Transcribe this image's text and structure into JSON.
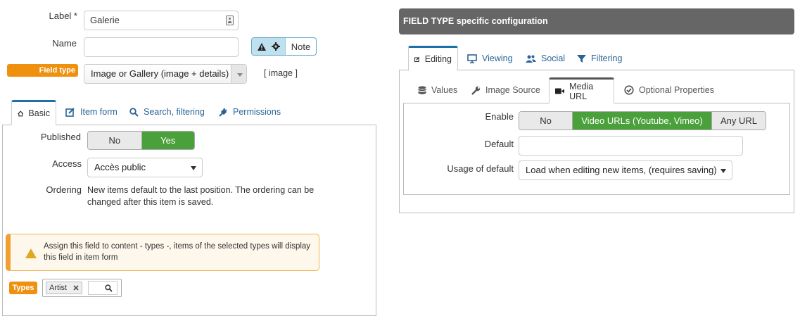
{
  "form": {
    "label_label": "Label *",
    "label_value": "Galerie",
    "name_label": "Name",
    "name_value": "",
    "note_label": "Note",
    "field_type_badge": "Field type",
    "field_type_value": "Image or Gallery (image + details)",
    "field_type_code": "[ image ]"
  },
  "left_tabs": [
    {
      "label": "Basic",
      "icon": "home-icon",
      "active": true
    },
    {
      "label": "Item form",
      "icon": "edit-icon",
      "active": false
    },
    {
      "label": "Search, filtering",
      "icon": "search-icon",
      "active": false
    },
    {
      "label": "Permissions",
      "icon": "plug-icon",
      "active": false
    }
  ],
  "basic": {
    "published_label": "Published",
    "published_options": [
      "No",
      "Yes"
    ],
    "published_selected": "Yes",
    "access_label": "Access",
    "access_value": "Accès public",
    "ordering_label": "Ordering",
    "ordering_text": "New items default to the last position. The ordering can be changed after this item is saved.",
    "warning_text": "Assign this field to content - types -, items of the selected types will display this field in item form",
    "types_badge": "Types",
    "types_tags": [
      "Artist"
    ]
  },
  "right": {
    "header_title": "FIELD TYPE specific configuration",
    "main_tabs": [
      {
        "label": "Editing",
        "icon": "edit-icon",
        "active": true
      },
      {
        "label": "Viewing",
        "icon": "monitor-icon",
        "active": false
      },
      {
        "label": "Social",
        "icon": "users-icon",
        "active": false
      },
      {
        "label": "Filtering",
        "icon": "filter-icon",
        "active": false
      }
    ],
    "sub_tabs": [
      {
        "label": "Values",
        "icon": "database-icon",
        "active": false
      },
      {
        "label": "Image Source",
        "icon": "wrench-icon",
        "active": false
      },
      {
        "label": "Media URL",
        "icon": "video-camera-icon",
        "active": true
      },
      {
        "label": "Optional Properties",
        "icon": "check-circle-icon",
        "active": false
      }
    ],
    "enable_label": "Enable",
    "enable_options": [
      "No",
      "Video URLs (Youtube, Vimeo)",
      "Any URL"
    ],
    "enable_selected": "Video URLs (Youtube, Vimeo)",
    "default_label": "Default",
    "default_value": "",
    "usage_label": "Usage of default",
    "usage_value": "Load when editing new items, (requires saving)"
  },
  "colors": {
    "accent_blue": "#1f6fa8",
    "link_blue": "#2a6496",
    "success_green": "#4aa03a",
    "warning_orange": "#f0900f",
    "header_grey": "#666666"
  }
}
